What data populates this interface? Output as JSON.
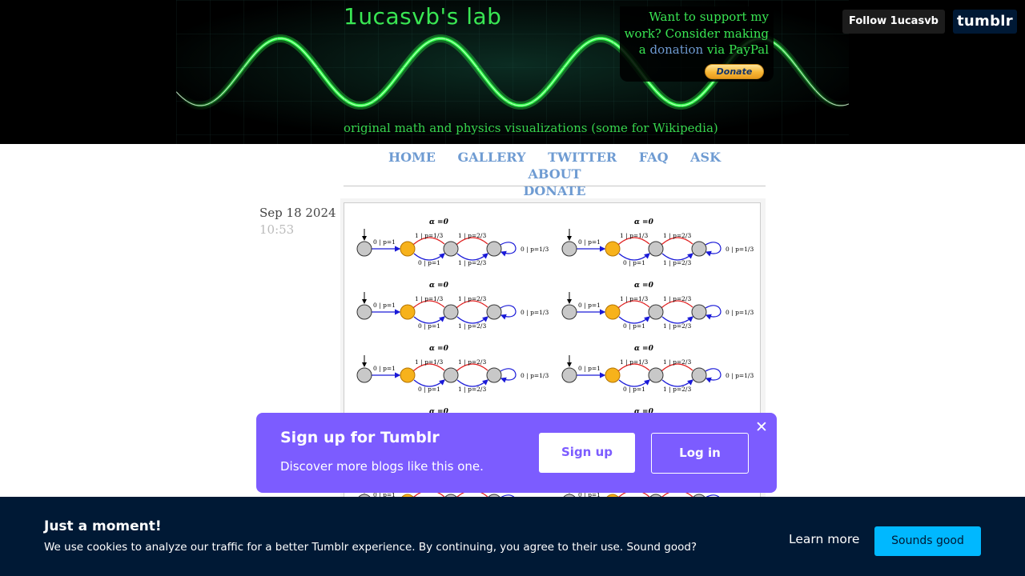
{
  "header": {
    "site_title": "1ucasvb's lab",
    "description": "original math and physics visualizations (some for Wikipedia)",
    "support": {
      "line1": "Want to support my",
      "line2": "work? Consider making",
      "line3_prefix": "a",
      "donation_link": "donation",
      "line3_suffix": "via PayPal",
      "donate_button": "Donate"
    },
    "follow_button": "Follow 1ucasvb",
    "tumblr_logo": "tumblr"
  },
  "nav": {
    "items": [
      "HOME",
      "GALLERY",
      "TWITTER",
      "FAQ",
      "ASK",
      "ABOUT",
      "DONATE"
    ]
  },
  "post": {
    "date": "Sep 18 2024",
    "time": "10:53",
    "diagram": {
      "alpha_label": "α =0",
      "labels": {
        "start": "0 | p=1",
        "top1": "1 | p=1/3",
        "top2": "1 | p=2/3",
        "loop": "0 | p=1/3",
        "bot1": "0 | p=1",
        "bot2": "1 | p=2/3"
      },
      "colors": {
        "highlight": "#f7b21b",
        "node": "#c8c8c8",
        "red": "#e02020",
        "blue": "#1a1ad8"
      }
    }
  },
  "signup": {
    "heading": "Sign up for Tumblr",
    "subtext": "Discover more blogs like this one.",
    "signup_button": "Sign up",
    "login_button": "Log in",
    "close_icon": "close-icon",
    "bg_color": "#7c5cff"
  },
  "cookie": {
    "heading": "Just a moment!",
    "text": "We use cookies to analyze our traffic for a better Tumblr experience. By continuing, you agree to their use. Sound good?",
    "learn_more": "Learn more",
    "accept_button": "Sounds good",
    "bg_color": "#001935",
    "accent_color": "#00b8ff"
  }
}
